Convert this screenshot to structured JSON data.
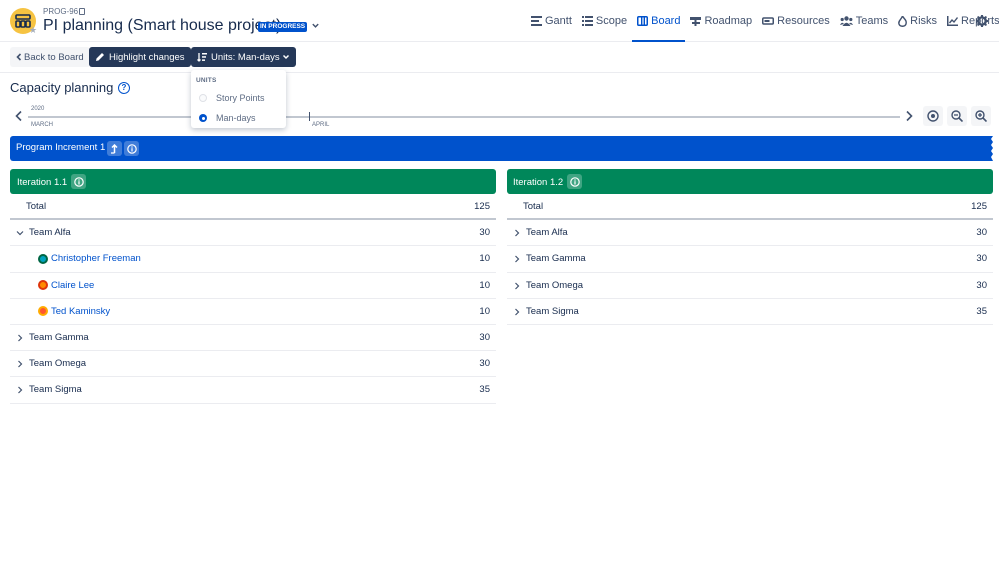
{
  "header": {
    "project_key": "PROG-96",
    "title": "PI planning (Smart house project)",
    "status": "IN PROGRESS",
    "nav": [
      {
        "label": "Gantt",
        "icon": "gantt-icon",
        "active": false
      },
      {
        "label": "Scope",
        "icon": "list-icon",
        "active": false
      },
      {
        "label": "Board",
        "icon": "board-icon",
        "active": true
      },
      {
        "label": "Roadmap",
        "icon": "roadmap-icon",
        "active": false
      },
      {
        "label": "Resources",
        "icon": "resources-icon",
        "active": false
      },
      {
        "label": "Teams",
        "icon": "teams-icon",
        "active": false
      },
      {
        "label": "Risks",
        "icon": "fire-icon",
        "active": false
      },
      {
        "label": "Reports",
        "icon": "chart-icon",
        "active": false
      }
    ]
  },
  "toolbar": {
    "back_label": "Back to Board",
    "highlight_label": "Highlight changes",
    "units_label": "Units: Man-days"
  },
  "units_dropdown": {
    "header": "UNITS",
    "options": [
      {
        "label": "Story Points",
        "selected": false
      },
      {
        "label": "Man-days",
        "selected": true
      }
    ]
  },
  "page": {
    "title": "Capacity planning"
  },
  "timeline": {
    "year": "2020",
    "months": [
      "MARCH",
      "APRIL"
    ]
  },
  "program_increment": {
    "label": "Program Increment 1"
  },
  "iterations": [
    {
      "label": "Iteration 1.1",
      "total_label": "Total",
      "total_value": "125",
      "rows": [
        {
          "name": "Team Alfa",
          "value": "30",
          "expanded": true
        },
        {
          "name": "Christopher Freeman",
          "value": "10",
          "person": true
        },
        {
          "name": "Claire Lee",
          "value": "10",
          "person": true
        },
        {
          "name": "Ted Kaminsky",
          "value": "10",
          "person": true
        },
        {
          "name": "Team Gamma",
          "value": "30",
          "expanded": false
        },
        {
          "name": "Team Omega",
          "value": "30",
          "expanded": false
        },
        {
          "name": "Team Sigma",
          "value": "35",
          "expanded": false
        }
      ]
    },
    {
      "label": "Iteration 1.2",
      "total_label": "Total",
      "total_value": "125",
      "rows": [
        {
          "name": "Team Alfa",
          "value": "30",
          "expanded": false
        },
        {
          "name": "Team Gamma",
          "value": "30",
          "expanded": false
        },
        {
          "name": "Team Omega",
          "value": "30",
          "expanded": false
        },
        {
          "name": "Team Sigma",
          "value": "35",
          "expanded": false
        }
      ]
    }
  ],
  "colors": {
    "primary": "#0052cc",
    "iteration": "#00875a",
    "dark_button": "#253858",
    "logo": "#f6c342"
  }
}
